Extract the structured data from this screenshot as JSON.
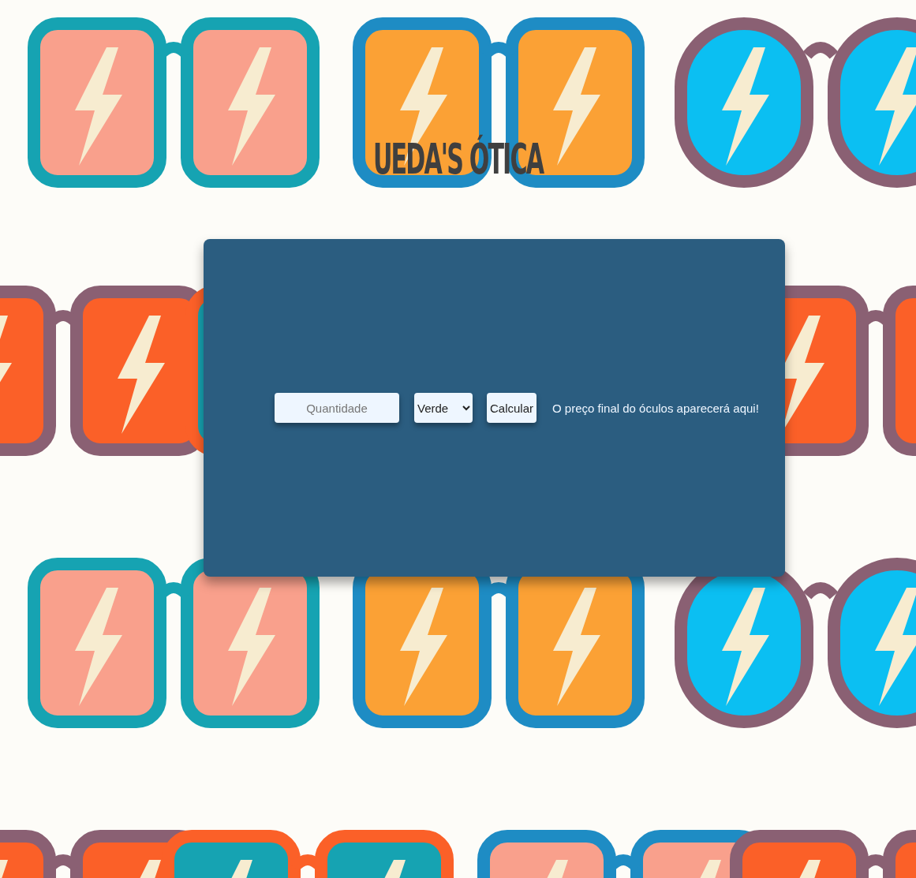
{
  "title": "UEDA'S ÓTICA",
  "form": {
    "quantity": {
      "placeholder": "Quantidade"
    },
    "color": {
      "value": "Verde"
    },
    "button": "Calcular",
    "result": "O preço final do óculos aparecerá aqui!"
  }
}
